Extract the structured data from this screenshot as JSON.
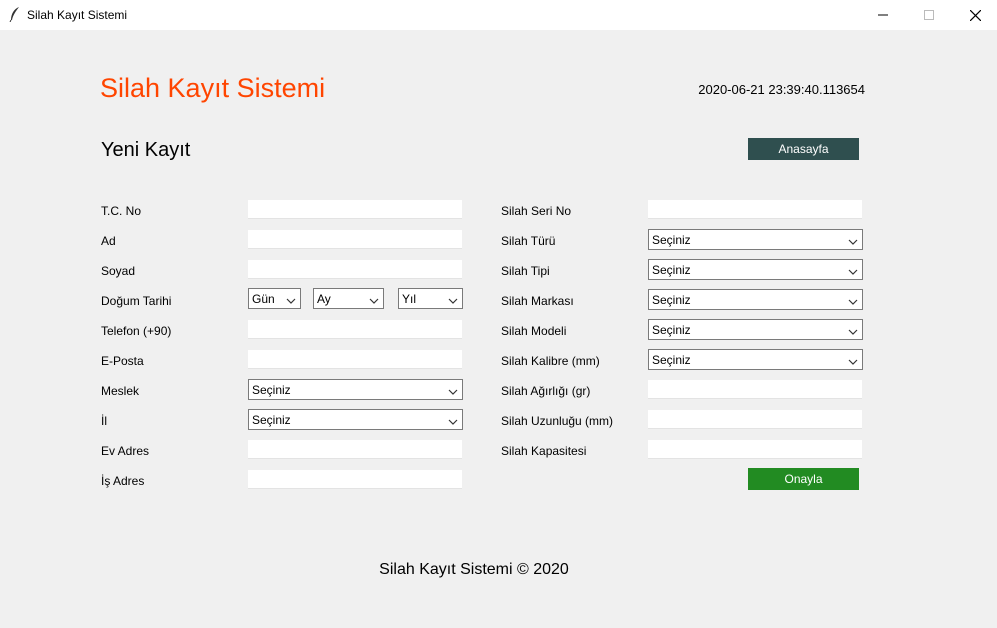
{
  "window": {
    "title": "Silah Kayıt Sistemi"
  },
  "header": {
    "title": "Silah Kayıt Sistemi",
    "datetime": "2020-06-21 23:39:40.113654"
  },
  "section": {
    "title": "Yeni Kayıt",
    "home_button": "Anasayfa"
  },
  "left_form": {
    "tc_no": "T.C. No",
    "ad": "Ad",
    "soyad": "Soyad",
    "dogum_tarihi": "Doğum Tarihi",
    "dogum_gun": "Gün",
    "dogum_ay": "Ay",
    "dogum_yil": "Yıl",
    "telefon": "Telefon (+90)",
    "eposta": "E-Posta",
    "meslek": "Meslek",
    "meslek_value": "Seçiniz",
    "il": "İl",
    "il_value": "Seçiniz",
    "ev_adres": "Ev Adres",
    "is_adres": "İş Adres"
  },
  "right_form": {
    "seri_no": "Silah Seri No",
    "turu": "Silah Türü",
    "turu_value": "Seçiniz",
    "tipi": "Silah Tipi",
    "tipi_value": "Seçiniz",
    "markasi": "Silah Markası",
    "markasi_value": "Seçiniz",
    "modeli": "Silah Modeli",
    "modeli_value": "Seçiniz",
    "kalibre": "Silah Kalibre (mm)",
    "kalibre_value": "Seçiniz",
    "agirligi": "Silah Ağırlığı (gr)",
    "uzunlugu": "Silah Uzunluğu (mm)",
    "kapasitesi": "Silah Kapasitesi"
  },
  "submit_button": "Onayla",
  "footer": "Silah Kayıt Sistemi © 2020"
}
